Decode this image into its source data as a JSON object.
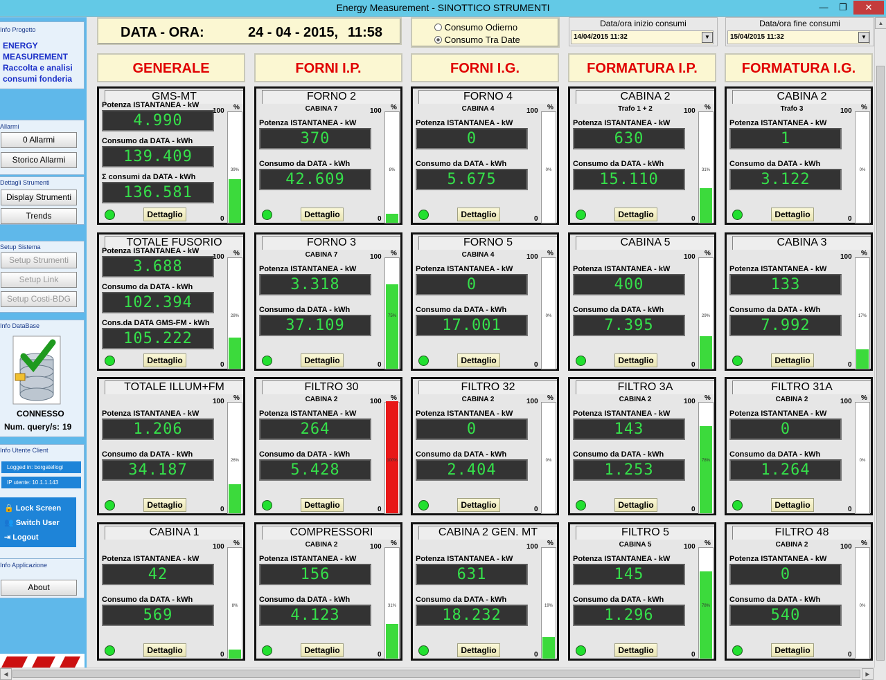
{
  "window": {
    "title": "Energy Measurement - SINOTTICO STRUMENTI",
    "minimize": "—",
    "restore": "❐",
    "close": "✕"
  },
  "sidebar": {
    "info_progetto": {
      "title": "Info Progetto",
      "line1": "ENERGY",
      "line2": "MEASUREMENT",
      "line3": "Raccolta e analisi",
      "line4": "consumi fonderia"
    },
    "allarmi": {
      "title": "Allarmi",
      "alarm_count_button": "0 Allarmi",
      "storico_button": "Storico Allarmi"
    },
    "dettagli": {
      "title": "Dettagli Strumenti",
      "display_button": "Display Strumenti",
      "trends_button": "Trends"
    },
    "setup": {
      "title": "Setup Sistema",
      "strumenti_button": "Setup Strumenti",
      "link_button": "Setup Link",
      "costi_button": "Setup Costi-BDG"
    },
    "database": {
      "title": "Info DataBase",
      "status": "CONNESSO",
      "query_label": "Num. query/s:",
      "query_value": "19"
    },
    "utente": {
      "title": "Info Utente Client",
      "logged": "Logged in: borgatellogi",
      "ip": "IP utente: 10.1.1.143",
      "lock": "Lock Screen",
      "switch": "Switch User",
      "logout": "Logout"
    },
    "applicazione": {
      "title": "Info Applicazione",
      "about_button": "About"
    }
  },
  "header": {
    "date_label": "DATA - ORA:",
    "date_value": "24 - 04 - 2015,",
    "time_value": "11:58",
    "radio1": "Consumo Odierno",
    "radio2": "Consumo Tra Date",
    "selected_radio": 2,
    "inizio_label": "Data/ora inizio consumi",
    "inizio_value": "14/04/2015   11:32",
    "fine_label": "Data/ora fine consumi",
    "fine_value": "15/04/2015   11:32"
  },
  "categories": [
    "GENERALE",
    "FORNI I.P.",
    "FORNI I.G.",
    "FORMATURA I.P.",
    "FORMATURA I.G."
  ],
  "common": {
    "max": "100",
    "min": "0",
    "pct": "%",
    "detail": "Dettaglio",
    "pot_label": "Potenza ISTANTANEA - kW",
    "cons_label": "Consumo da DATA - kWh"
  },
  "panels": [
    {
      "title": "GMS-MT",
      "sub": "",
      "pot": "4.990",
      "cons": "139.409",
      "extra_label": "Σ consumi da DATA - kWh",
      "extra": "136.581",
      "percent": 39,
      "percent_text": "39%",
      "color": "#3cda3c"
    },
    {
      "title": "FORNO 2",
      "sub": "CABINA 7",
      "pot": "370",
      "cons": "42.609",
      "percent": 8,
      "percent_text": "8%",
      "color": "#3cda3c"
    },
    {
      "title": "FORNO 4",
      "sub": "CABINA 4",
      "pot": "0",
      "cons": "5.675",
      "percent": 0,
      "percent_text": "0%",
      "color": "#3cda3c"
    },
    {
      "title": "CABINA 2",
      "sub": "Trafo 1 + 2",
      "pot": "630",
      "cons": "15.110",
      "percent": 31,
      "percent_text": "31%",
      "color": "#3cda3c"
    },
    {
      "title": "CABINA 2",
      "sub": "Trafo 3",
      "pot": "1",
      "cons": "3.122",
      "percent": 0,
      "percent_text": "0%",
      "color": "#3cda3c"
    },
    {
      "title": "TOTALE FUSORIO",
      "sub": "",
      "pot": "3.688",
      "cons": "102.394",
      "extra_label": "Cons.da DATA GMS-FM - kWh",
      "extra": "105.222",
      "percent": 28,
      "percent_text": "28%",
      "color": "#3cda3c"
    },
    {
      "title": "FORNO 3",
      "sub": "CABINA 7",
      "pot": "3.318",
      "cons": "37.109",
      "percent": 75,
      "percent_text": "75%",
      "color": "#3cda3c"
    },
    {
      "title": "FORNO 5",
      "sub": "CABINA 4",
      "pot": "0",
      "cons": "17.001",
      "percent": 0,
      "percent_text": "0%",
      "color": "#3cda3c"
    },
    {
      "title": "CABINA 5",
      "sub": "",
      "pot": "400",
      "cons": "7.395",
      "percent": 29,
      "percent_text": "29%",
      "color": "#3cda3c"
    },
    {
      "title": "CABINA 3",
      "sub": "",
      "pot": "133",
      "cons": "7.992",
      "percent": 17,
      "percent_text": "17%",
      "color": "#3cda3c"
    },
    {
      "title": "TOTALE ILLUM+FM",
      "sub": "",
      "pot": "1.206",
      "cons": "34.187",
      "percent": 26,
      "percent_text": "26%",
      "color": "#3cda3c"
    },
    {
      "title": "FILTRO 30",
      "sub": "CABINA 2",
      "pot": "264",
      "cons": "5.428",
      "percent": 100,
      "percent_text": "100%",
      "color": "#e81818"
    },
    {
      "title": "FILTRO 32",
      "sub": "CABINA 2",
      "pot": "0",
      "cons": "2.404",
      "percent": 0,
      "percent_text": "0%",
      "color": "#3cda3c"
    },
    {
      "title": "FILTRO 3A",
      "sub": "CABINA 2",
      "pot": "143",
      "cons": "1.253",
      "percent": 78,
      "percent_text": "78%",
      "color": "#3cda3c"
    },
    {
      "title": "FILTRO 31A",
      "sub": "CABINA 2",
      "pot": "0",
      "cons": "1.264",
      "percent": 0,
      "percent_text": "0%",
      "color": "#3cda3c"
    },
    {
      "title": "CABINA 1",
      "sub": "",
      "pot": "42",
      "cons": "569",
      "percent": 8,
      "percent_text": "8%",
      "color": "#3cda3c"
    },
    {
      "title": "COMPRESSORI",
      "sub": "CABINA 2",
      "pot": "156",
      "cons": "4.123",
      "percent": 31,
      "percent_text": "31%",
      "color": "#3cda3c"
    },
    {
      "title": "CABINA 2 GEN. MT",
      "sub": "",
      "pot": "631",
      "cons": "18.232",
      "percent": 19,
      "percent_text": "19%",
      "color": "#3cda3c"
    },
    {
      "title": "FILTRO 5",
      "sub": "CABINA 5",
      "pot": "145",
      "cons": "1.296",
      "percent": 78,
      "percent_text": "78%",
      "color": "#3cda3c"
    },
    {
      "title": "FILTRO 48",
      "sub": "CABINA 2",
      "pot": "0",
      "cons": "540",
      "percent": 0,
      "percent_text": "0%",
      "color": "#3cda3c"
    }
  ]
}
